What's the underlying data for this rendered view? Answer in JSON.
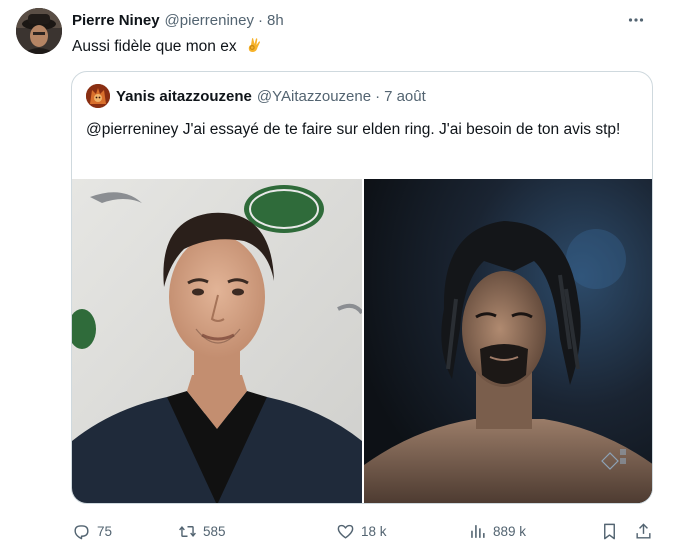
{
  "author": {
    "name": "Pierre Niney",
    "handle": "@pierreniney",
    "separator": "·",
    "time": "8h"
  },
  "tweet": {
    "text": "Aussi fidèle que mon ex",
    "emoji": "ok-hand-emoji"
  },
  "quoted": {
    "name": "Yanis aitazzouzene",
    "handle": "@YAitazzouzene",
    "separator": "·",
    "time": "7 août",
    "text": "@pierreniney J'ai essayé de te faire sur elden ring. J'ai besoin de ton avis stp!",
    "photo_left_sign_text": "LAND ROVER",
    "photo_left_logo_text": "JAGUA"
  },
  "actions": {
    "replies": "75",
    "reposts": "585",
    "likes": "18 k",
    "views": "889 k"
  },
  "icons": {
    "more": "more-options-icon",
    "reply": "reply-icon",
    "repost": "repost-icon",
    "like": "heart-icon",
    "views": "analytics-icon",
    "bookmark": "bookmark-icon",
    "share": "share-icon"
  },
  "colors": {
    "text": "#0f1419",
    "muted": "#536471",
    "border": "#cfd9de"
  }
}
